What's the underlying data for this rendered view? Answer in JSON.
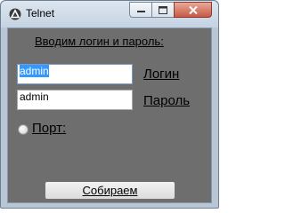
{
  "window": {
    "title": "Telnet",
    "icon": "telnet-app-icon",
    "caption_buttons": [
      "minimize-icon",
      "maximize-icon",
      "close-icon"
    ]
  },
  "form": {
    "heading": "Вводим логин и пароль:",
    "login": {
      "value": "admin",
      "label": "Логин"
    },
    "password": {
      "value": "admin",
      "label": "Пароль"
    },
    "port": {
      "label": "Порт:",
      "checked": false
    },
    "submit_label": "Собираем"
  },
  "colors": {
    "client_background": "#6e6e6e",
    "frame": "#b8c6d6",
    "selection": "#3399ff",
    "close_button": "#c75a45"
  }
}
